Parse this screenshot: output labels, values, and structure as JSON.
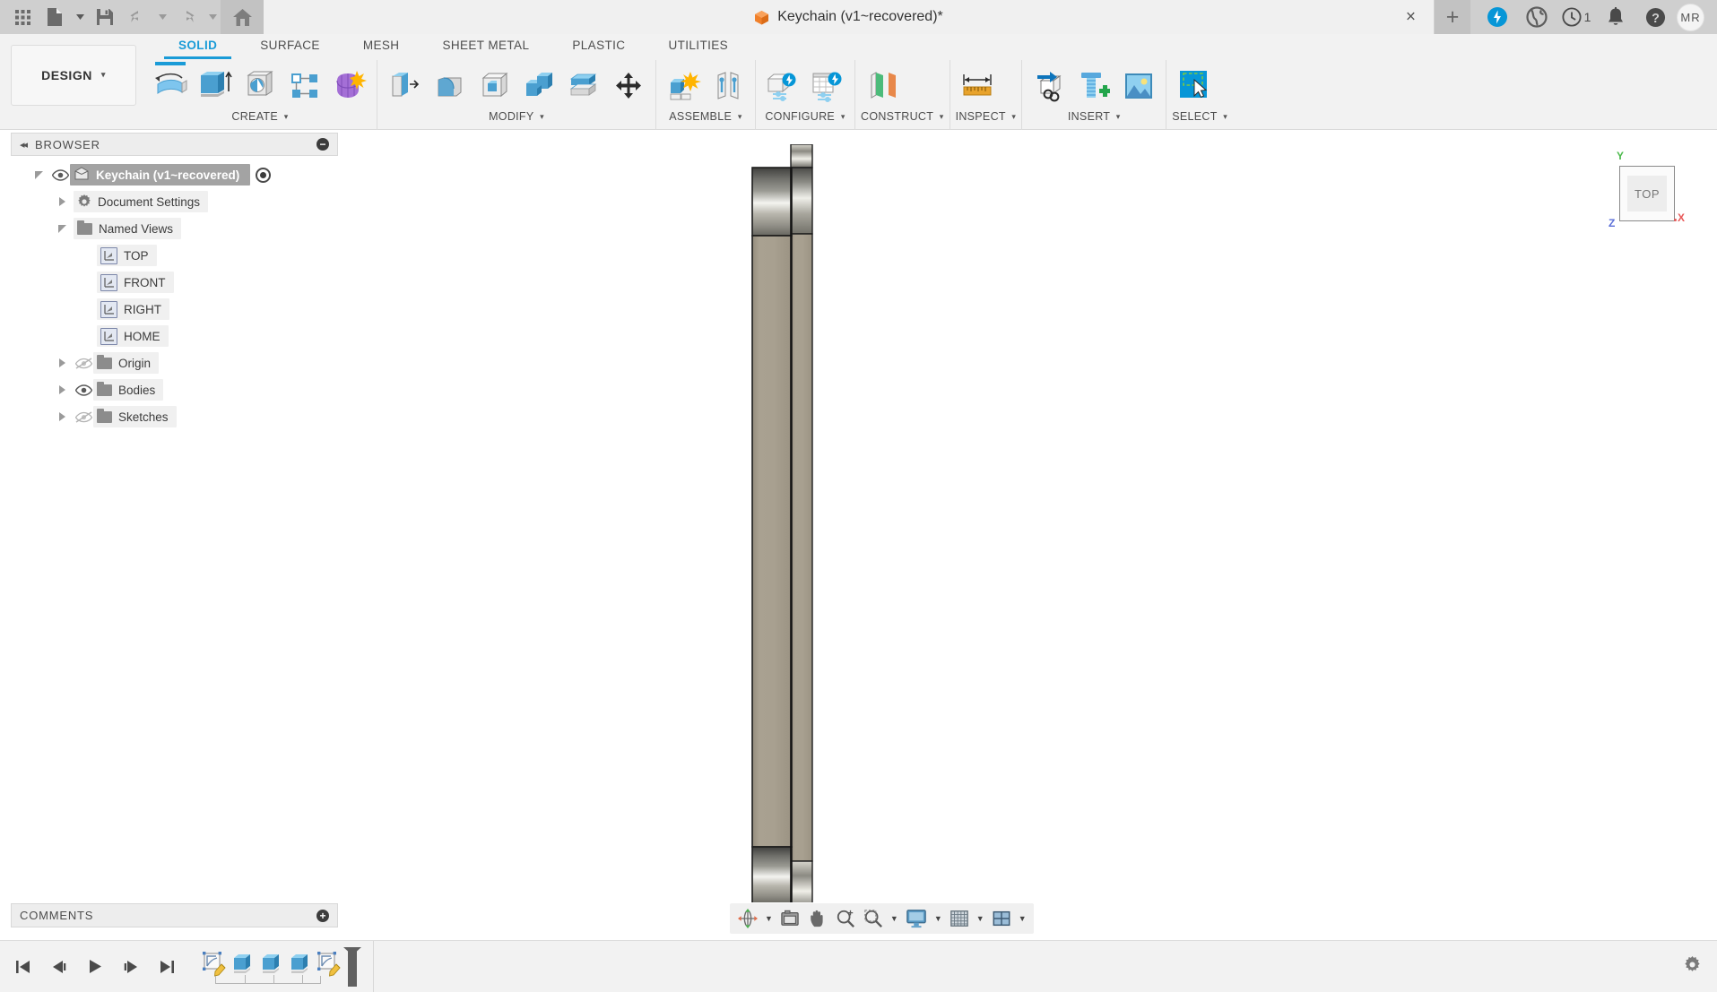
{
  "app": {
    "title": "Keychain (v1~recovered)*",
    "title_icon": "orange-cube-icon"
  },
  "titlebar": {
    "left_buttons": [
      {
        "name": "app-grid-icon",
        "label": "Grid"
      },
      {
        "name": "new-file-icon",
        "label": "New"
      },
      {
        "name": "new-file-caret",
        "label": "▾"
      },
      {
        "name": "save-icon",
        "label": "Save"
      },
      {
        "name": "undo-icon",
        "label": "Undo"
      },
      {
        "name": "undo-caret",
        "label": "▾"
      },
      {
        "name": "redo-icon",
        "label": "Redo"
      },
      {
        "name": "redo-caret",
        "label": "▾"
      },
      {
        "name": "home-icon",
        "label": "Home"
      }
    ],
    "tab_close": "×",
    "new_tab": "+",
    "right_icons": [
      {
        "name": "extension-blue-icon",
        "label": "Extension"
      },
      {
        "name": "world-globe-icon",
        "label": "Data Panel"
      },
      {
        "name": "job-status-icon",
        "label": "Job Status"
      },
      {
        "name": "notifications-bell-icon",
        "label": "Notifications"
      },
      {
        "name": "help-question-icon",
        "label": "Help"
      }
    ],
    "job_count": "1",
    "avatar_initials": "MR"
  },
  "ribbon": {
    "design_label": "DESIGN",
    "design_caret": "▾",
    "tabs": [
      {
        "label": "SOLID",
        "active": true
      },
      {
        "label": "SURFACE",
        "active": false
      },
      {
        "label": "MESH",
        "active": false
      },
      {
        "label": "SHEET METAL",
        "active": false
      },
      {
        "label": "PLASTIC",
        "active": false
      },
      {
        "label": "UTILITIES",
        "active": false
      }
    ],
    "panels": [
      {
        "label": "CREATE",
        "caret": "▾",
        "tools": [
          {
            "name": "create-sketch-icon",
            "title": "Create Sketch"
          },
          {
            "name": "extrude-icon",
            "title": "Extrude"
          },
          {
            "name": "revolve-icon",
            "title": "Revolve"
          },
          {
            "name": "pattern-icon",
            "title": "Pattern"
          },
          {
            "name": "form-icon",
            "title": "Create Form"
          }
        ]
      },
      {
        "label": "MODIFY",
        "caret": "▾",
        "tools": [
          {
            "name": "press-pull-icon",
            "title": "Press Pull"
          },
          {
            "name": "fillet-icon",
            "title": "Fillet"
          },
          {
            "name": "shell-icon",
            "title": "Shell"
          },
          {
            "name": "combine-icon",
            "title": "Combine"
          },
          {
            "name": "split-face-icon",
            "title": "Split Face"
          },
          {
            "name": "move-copy-icon",
            "title": "Move/Copy"
          }
        ]
      },
      {
        "label": "ASSEMBLE",
        "caret": "▾",
        "tools": [
          {
            "name": "new-component-icon",
            "title": "New Component"
          },
          {
            "name": "joint-icon",
            "title": "Joint"
          }
        ]
      },
      {
        "label": "CONFIGURE",
        "caret": "▾",
        "tools": [
          {
            "name": "configuration-icon",
            "title": "Create Configuration"
          },
          {
            "name": "configuration-table-icon",
            "title": "Edit Configuration Table"
          }
        ]
      },
      {
        "label": "CONSTRUCT",
        "caret": "▾",
        "tools": [
          {
            "name": "offset-plane-icon",
            "title": "Offset Plane"
          }
        ]
      },
      {
        "label": "INSPECT",
        "caret": "▾",
        "tools": [
          {
            "name": "measure-icon",
            "title": "Measure"
          }
        ]
      },
      {
        "label": "INSERT",
        "caret": "▾",
        "tools": [
          {
            "name": "insert-derive-icon",
            "title": "Insert Derive"
          },
          {
            "name": "mcmaster-bolt-icon",
            "title": "McMaster-Carr Component"
          },
          {
            "name": "canvas-image-icon",
            "title": "Canvas"
          }
        ]
      },
      {
        "label": "SELECT",
        "caret": "▾",
        "tools": [
          {
            "name": "select-tool-icon",
            "title": "Select"
          }
        ]
      }
    ]
  },
  "browser": {
    "header": "BROWSER",
    "collapse_icon": "collapse-left-arrows-icon",
    "minimize_icon": "circle-minus-icon",
    "tree": [
      {
        "label": "Keychain (v1~recovered)",
        "indent": 0,
        "twisty": "open",
        "eye": "visible",
        "icon": "component-cube-icon",
        "selected": true,
        "radio": true
      },
      {
        "label": "Document Settings",
        "indent": 1,
        "twisty": "closed",
        "eye": "none",
        "icon": "gear-icon",
        "selected": false,
        "radio": false
      },
      {
        "label": "Named Views",
        "indent": 1,
        "twisty": "open",
        "eye": "none",
        "icon": "folder-icon",
        "selected": false,
        "radio": false
      },
      {
        "label": "TOP",
        "indent": 2,
        "twisty": "none",
        "eye": "none",
        "icon": "named-view-icon",
        "selected": false,
        "radio": false
      },
      {
        "label": "FRONT",
        "indent": 2,
        "twisty": "none",
        "eye": "none",
        "icon": "named-view-icon",
        "selected": false,
        "radio": false
      },
      {
        "label": "RIGHT",
        "indent": 2,
        "twisty": "none",
        "eye": "none",
        "icon": "named-view-icon",
        "selected": false,
        "radio": false
      },
      {
        "label": "HOME",
        "indent": 2,
        "twisty": "none",
        "eye": "none",
        "icon": "named-view-icon",
        "selected": false,
        "radio": false
      },
      {
        "label": "Origin",
        "indent": 1,
        "twisty": "closed",
        "eye": "hidden",
        "icon": "folder-icon",
        "selected": false,
        "radio": false
      },
      {
        "label": "Bodies",
        "indent": 1,
        "twisty": "closed",
        "eye": "visible",
        "icon": "folder-icon",
        "selected": false,
        "radio": false
      },
      {
        "label": "Sketches",
        "indent": 1,
        "twisty": "closed",
        "eye": "hidden",
        "icon": "folder-icon",
        "selected": false,
        "radio": false
      }
    ]
  },
  "viewcube": {
    "face_label": "TOP",
    "axis_x": "X",
    "axis_y": "Y",
    "axis_z": "Z",
    "colors": {
      "x": "#e85a5a",
      "y": "#4cba4c",
      "z": "#5b6fd8"
    }
  },
  "canvas": {
    "model_name": "keychain-body",
    "model_color": "#a39b8b",
    "background": "#ffffff"
  },
  "navbar": {
    "buttons": [
      {
        "name": "orbit-icon",
        "label": "Orbit",
        "caret": "▾"
      },
      {
        "name": "look-at-icon",
        "label": "Look At",
        "caret": ""
      },
      {
        "name": "pan-icon",
        "label": "Pan",
        "caret": ""
      },
      {
        "name": "zoom-icon",
        "label": "Zoom",
        "caret": ""
      },
      {
        "name": "zoom-window-icon",
        "label": "Fit",
        "caret": "▾"
      },
      {
        "name": "display-settings-icon",
        "label": "Display Settings",
        "caret": "▾"
      },
      {
        "name": "grid-snaps-icon",
        "label": "Grid and Snaps",
        "caret": "▾"
      },
      {
        "name": "viewports-icon",
        "label": "Viewports",
        "caret": "▾"
      }
    ]
  },
  "comments": {
    "header": "COMMENTS",
    "add_icon": "circle-plus-icon"
  },
  "timeline": {
    "playback": [
      {
        "name": "go-to-beginning-icon",
        "label": "Go to beginning"
      },
      {
        "name": "step-back-icon",
        "label": "Step back"
      },
      {
        "name": "play-icon",
        "label": "Play"
      },
      {
        "name": "step-forward-icon",
        "label": "Step forward"
      },
      {
        "name": "go-to-end-icon",
        "label": "Go to end"
      }
    ],
    "features": [
      {
        "name": "timeline-sketch-1",
        "type": "sketch",
        "label": "Sketch1"
      },
      {
        "name": "timeline-extrude-1",
        "type": "extrude",
        "label": "Extrude1"
      },
      {
        "name": "timeline-extrude-2",
        "type": "extrude",
        "label": "Extrude2"
      },
      {
        "name": "timeline-extrude-3",
        "type": "extrude",
        "label": "Extrude3"
      },
      {
        "name": "timeline-sketch-2",
        "type": "sketch",
        "label": "Sketch2"
      }
    ],
    "settings_icon": "gear-icon"
  }
}
